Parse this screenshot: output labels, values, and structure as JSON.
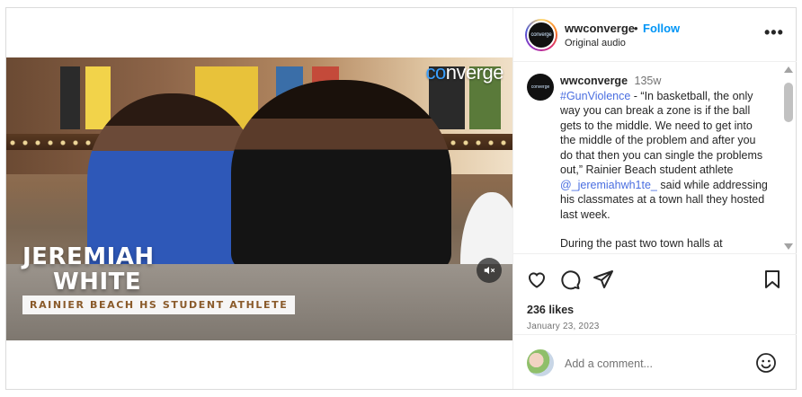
{
  "video": {
    "brand_prefix": "co",
    "brand_suffix": "nverge",
    "caption_name_line1": "JEREMIAH",
    "caption_name_line2": "WHITE",
    "caption_title": "RAINIER BEACH HS STUDENT ATHLETE",
    "mute_icon": "speaker-muted-icon"
  },
  "header": {
    "username": "wwconverge",
    "separator": "•",
    "follow_label": "Follow",
    "audio_label": "Original audio",
    "more_icon": "more-horizontal-icon",
    "avatar_text": "converge"
  },
  "caption": {
    "username": "wwconverge",
    "time": "135w",
    "hashtag": "#GunViolence",
    "text_before_mention": " - “In basketball, the only way you can break a zone is if the ball gets to the middle. We need to get into the middle of the problem and after you do that then you can single the problems out,” Rainier Beach student athlete ",
    "mention": "@_jeremiahwh1te_",
    "text_after_mention": " said while addressing his classmates at a town hall they hosted last week.",
    "para2": "During the past two town halls at"
  },
  "actions": {
    "likes": "236 likes",
    "date": "January 23, 2023",
    "icons": [
      "heart-icon",
      "comment-icon",
      "share-icon",
      "bookmark-icon"
    ]
  },
  "comment_box": {
    "placeholder": "Add a comment...",
    "emoji_icon": "emoji-icon"
  },
  "colors": {
    "link_blue": "#0095f6",
    "hashtag_blue": "#4a6ee0",
    "muted_gray": "#737373"
  }
}
